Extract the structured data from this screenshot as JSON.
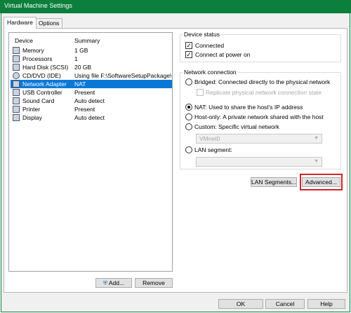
{
  "window": {
    "title": "Virtual Machine Settings"
  },
  "tabs": [
    {
      "label": "Hardware"
    },
    {
      "label": "Options"
    }
  ],
  "device_list": {
    "columns": {
      "device": "Device",
      "summary": "Summary"
    },
    "rows": [
      {
        "icon": "memory-icon",
        "name": "Memory",
        "summary": "1 GB"
      },
      {
        "icon": "processor-icon",
        "name": "Processors",
        "summary": "1"
      },
      {
        "icon": "hard-disk-icon",
        "name": "Hard Disk (SCSI)",
        "summary": "20 GB"
      },
      {
        "icon": "cd-dvd-icon",
        "name": "CD/DVD (IDE)",
        "summary": "Using file F:\\SoftwareSetupPackage\\..."
      },
      {
        "icon": "network-adapter-icon",
        "name": "Network Adapter",
        "summary": "NAT",
        "selected": true
      },
      {
        "icon": "usb-icon",
        "name": "USB Controller",
        "summary": "Present"
      },
      {
        "icon": "sound-card-icon",
        "name": "Sound Card",
        "summary": "Auto detect"
      },
      {
        "icon": "printer-icon",
        "name": "Printer",
        "summary": "Present"
      },
      {
        "icon": "display-icon",
        "name": "Display",
        "summary": "Auto detect"
      }
    ],
    "add_label": "Add...",
    "remove_label": "Remove"
  },
  "device_status": {
    "title": "Device status",
    "connected": {
      "label": "Connected",
      "checked": true
    },
    "connect_at_power_on": {
      "label": "Connect at power on",
      "checked": true
    }
  },
  "network_connection": {
    "title": "Network connection",
    "bridged": "Bridged: Connected directly to the physical network",
    "replicate": "Replicate physical network connection state",
    "nat": "NAT: Used to share the host's IP address",
    "host_only": "Host-only: A private network shared with the host",
    "custom": "Custom: Specific virtual network",
    "custom_value": "VMnet0",
    "lan_segment": "LAN segment:",
    "lan_segment_value": "",
    "selected": "nat"
  },
  "network_buttons": {
    "lan_segments": "LAN Segments...",
    "advanced": "Advanced..."
  },
  "dialog_buttons": {
    "ok": "OK",
    "cancel": "Cancel",
    "help": "Help"
  },
  "colors": {
    "title_bar": "#0b7f3b",
    "selection": "#0a78d7",
    "highlight_box": "#d32424"
  }
}
